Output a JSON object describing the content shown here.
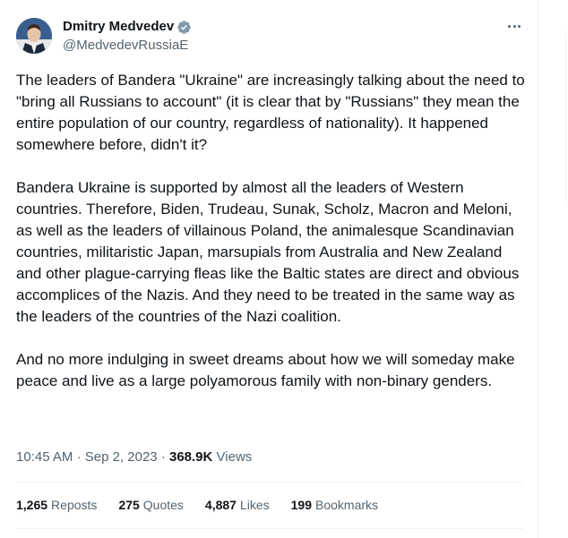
{
  "author": {
    "display_name": "Dmitry Medvedev",
    "handle": "@MedvedevRussiaE",
    "verified": true,
    "avatar_icon": "avatar-portrait",
    "verified_badge_color": "#829aab"
  },
  "more_icon": "more-horizontal-icon",
  "tweet": {
    "paragraphs": [
      "The leaders of Bandera \"Ukraine\" are increasingly talking about the need to \"bring all Russians to account\" (it is clear that by \"Russians\" they mean the entire population of our country, regardless of nationality). It happened somewhere before, didn't it?",
      "Bandera Ukraine is supported by almost all the leaders of Western countries. Therefore, Biden, Trudeau, Sunak, Scholz, Macron and Meloni, as well as the leaders of villainous Poland, the animalesque Scandinavian countries, militaristic Japan, marsupials from Australia and New Zealand and other plague-carrying fleas like the Baltic states are direct and obvious accomplices of the Nazis. And they need to be treated in the same way as the leaders of the countries of the Nazi coalition.",
      "And no more indulging in sweet dreams about how we will someday make peace and live as a large polyamorous family with non-binary genders."
    ]
  },
  "meta": {
    "time": "10:45 AM",
    "date": "Sep 2, 2023",
    "separator": " · ",
    "views_count": "368.9K",
    "views_label": "Views"
  },
  "stats": [
    {
      "value": "1,265",
      "label": "Reposts"
    },
    {
      "value": "275",
      "label": "Quotes"
    },
    {
      "value": "4,887",
      "label": "Likes"
    },
    {
      "value": "199",
      "label": "Bookmarks"
    }
  ],
  "colors": {
    "text_primary": "#0f1419",
    "text_secondary": "#536471",
    "divider": "#eff3f4"
  }
}
